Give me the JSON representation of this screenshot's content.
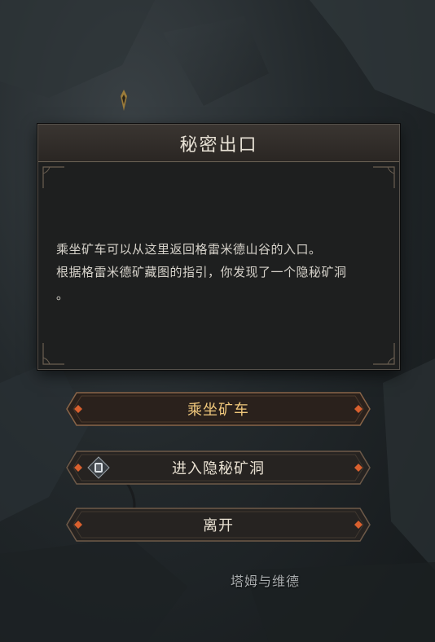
{
  "dialog": {
    "title": "秘密出口",
    "body_line1": "乘坐矿车可以从这里返回格雷米德山谷的入口。",
    "body_line2": "根据格雷米德矿藏图的指引，你发现了一个隐秘矿洞",
    "body_line3": "。"
  },
  "options": [
    {
      "label": "乘坐矿车"
    },
    {
      "label": "进入隐秘矿洞"
    },
    {
      "label": "离开"
    }
  ],
  "map": {
    "location_label": "塔姆与维德"
  },
  "colors": {
    "accent_gold": "#f0c87c",
    "gem_red": "#d9602e",
    "frame_brown": "#7a5a41"
  }
}
